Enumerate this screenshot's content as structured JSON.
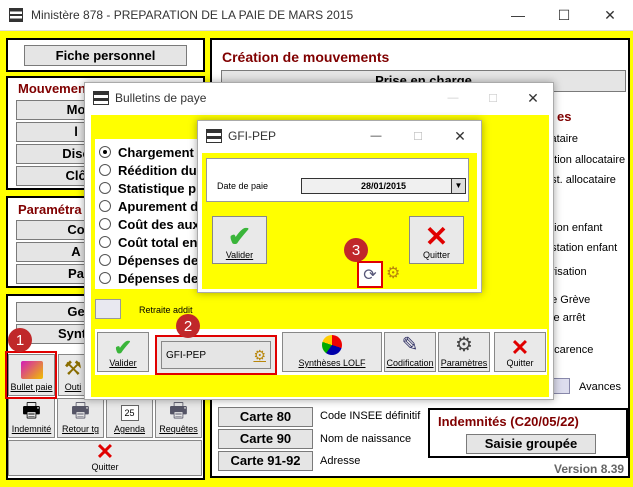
{
  "main_window": {
    "title": "Ministère 878 - PREPARATION DE LA PAIE DE MARS 2015",
    "controls": {
      "minimize": "—",
      "maximize": "☐",
      "close": "✕"
    },
    "fiche_personnel": "Fiche personnel",
    "mouvements": {
      "title": "Mouvement",
      "buttons": [
        "Mo",
        "l",
        "Disc",
        "Clô"
      ]
    },
    "parametrage": {
      "title": "Paramétra",
      "buttons": [
        "Co",
        "A",
        "Pa"
      ]
    },
    "lower_buttons": [
      "Ge",
      "Synth"
    ],
    "toolbar": [
      {
        "label": "Bullet paie",
        "icon": "bulletin-icon"
      },
      {
        "label": "Outi",
        "icon": "tools-icon"
      },
      {
        "label": "Indemnité",
        "icon": "indemnite-icon"
      },
      {
        "label": "Retour tg",
        "icon": "printer-icon"
      },
      {
        "label": "Agenda",
        "icon": "calendar-icon"
      },
      {
        "label": "Requêtes",
        "icon": "printer-icon"
      }
    ],
    "quitter": "Quitter",
    "creation": {
      "title": "Création de mouvements",
      "prise_en_charge": "Prise en charge",
      "right_items": [
        "es",
        "cataire",
        "tation allocataire",
        "est. allocataire",
        "ts",
        "ation enfant",
        "estation enfant",
        "arisation",
        "ue Grève",
        "ole arrêt",
        "ie",
        "e carence"
      ],
      "paren": "l)",
      "avances": "Avances"
    },
    "cartes": [
      {
        "label": "Carte 80",
        "desc": "Code INSEE définitif"
      },
      {
        "label": "Carte 90",
        "desc": "Nom de naissance"
      },
      {
        "label": "Carte 91-92",
        "desc": "Adresse"
      }
    ],
    "indemnites": {
      "title": "Indemnités (C20/05/22)",
      "saisie": "Saisie groupée"
    },
    "version": "Version 8.39"
  },
  "bulletins": {
    "title": "Bulletins de paye",
    "options": [
      "Chargement",
      "Réédition du",
      "Statistique p",
      "Apurement d",
      "Coût des aux",
      "Coût total en",
      "Dépenses de",
      "Dépenses de"
    ],
    "retraite": "Retraite addit",
    "buttons": {
      "valider": "Valider",
      "gfi": "GFI-PEP",
      "syntheses": "Synthèses LOLF",
      "codification": "Codification",
      "parametres": "Paramètres",
      "quitter": "Quitter"
    }
  },
  "gfi": {
    "title": "GFI-PEP",
    "date_label": "Date de paie",
    "date_value": "28/01/2015",
    "valider": "Valider",
    "quitter": "Quitter"
  },
  "badges": [
    "1",
    "2",
    "3"
  ]
}
